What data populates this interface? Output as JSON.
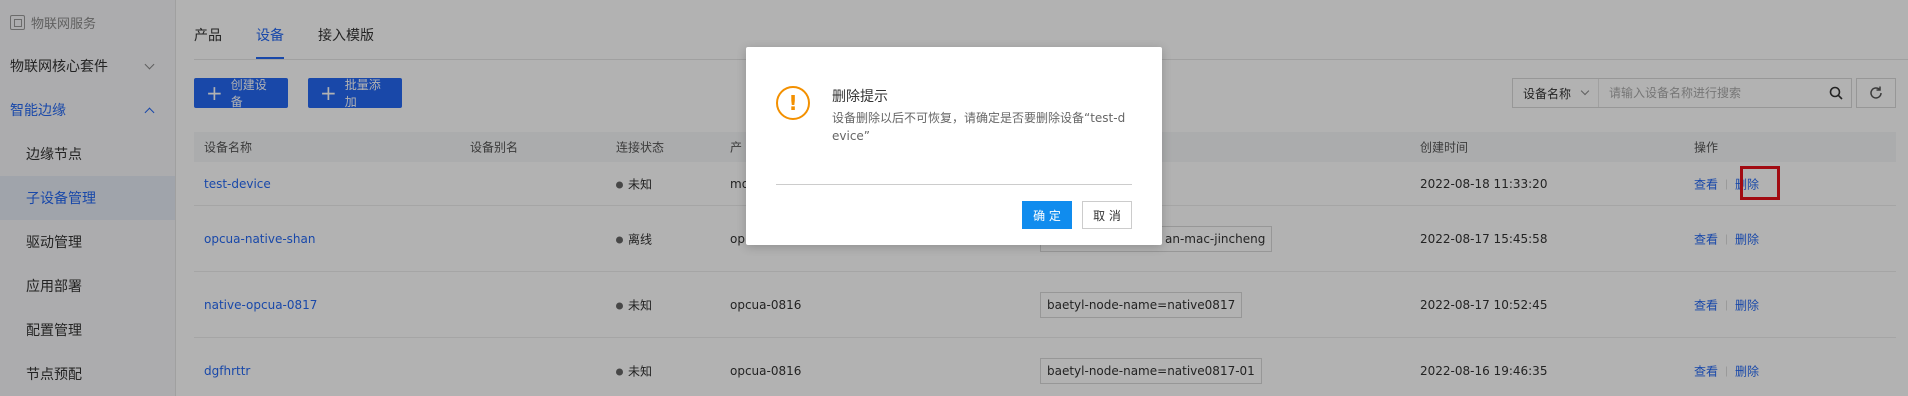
{
  "sidebar": {
    "title": "物联网服务",
    "groups": [
      {
        "label": "物联网核心套件"
      },
      {
        "label": "智能边缘"
      }
    ],
    "items": [
      {
        "label": "边缘节点"
      },
      {
        "label": "子设备管理"
      },
      {
        "label": "驱动管理"
      },
      {
        "label": "应用部署"
      },
      {
        "label": "配置管理"
      },
      {
        "label": "节点预配"
      }
    ]
  },
  "tabs": [
    {
      "label": "产品"
    },
    {
      "label": "设备"
    },
    {
      "label": "接入模版"
    }
  ],
  "toolbar": {
    "create_label": "创建设备",
    "batch_label": "批量添加",
    "search_select": "设备名称",
    "search_placeholder": "请输入设备名称进行搜索"
  },
  "table": {
    "headers": [
      "设备名称",
      "设备别名",
      "连接状态",
      "产",
      "创建时间",
      "操作"
    ],
    "rows": [
      {
        "name": "test-device",
        "alias": "",
        "status": "未知",
        "product": "mo",
        "tag": "",
        "created": "2022-08-18 11:33:20",
        "view": "查看",
        "delete": "删除"
      },
      {
        "name": "opcua-native-shan",
        "alias": "",
        "status": "离线",
        "product": "op",
        "tag": "an-mac-jincheng",
        "created": "2022-08-17 15:45:58",
        "view": "查看",
        "delete": "删除"
      },
      {
        "name": "native-opcua-0817",
        "alias": "",
        "status": "未知",
        "product": "opcua-0816",
        "tag": "baetyl-node-name=native0817",
        "created": "2022-08-17 10:52:45",
        "view": "查看",
        "delete": "删除"
      },
      {
        "name": "dgfhrttr",
        "alias": "",
        "status": "未知",
        "product": "opcua-0816",
        "tag": "baetyl-node-name=native0817-01",
        "created": "2022-08-16 19:46:35",
        "view": "查看",
        "delete": "删除"
      }
    ]
  },
  "dialog": {
    "title": "删除提示",
    "message": "设备删除以后不可恢复，请确定是否要删除设备“test-device”",
    "confirm": "确 定",
    "cancel": "取 消"
  },
  "colors": {
    "accent": "#2468f2",
    "warning": "#f39000",
    "highlight": "#e8101a",
    "confirm_button": "#108cee"
  }
}
